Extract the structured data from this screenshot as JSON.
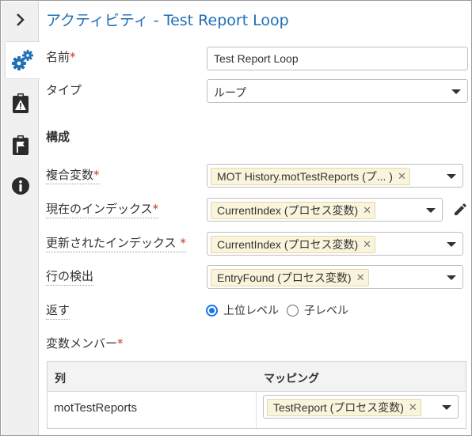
{
  "header": {
    "title": "アクティビティ  - Test Report Loop"
  },
  "sidebar": {
    "items": [
      {
        "name": "collapse",
        "icon": "chevron-right-icon"
      },
      {
        "name": "settings",
        "icon": "gears-icon",
        "active": true
      },
      {
        "name": "warning",
        "icon": "clipboard-warning-icon"
      },
      {
        "name": "flag",
        "icon": "flag-icon"
      },
      {
        "name": "info",
        "icon": "info-icon"
      }
    ]
  },
  "form": {
    "name_label": "名前",
    "name_value": "Test Report Loop",
    "type_label": "タイプ",
    "type_value": "ループ",
    "section_title": "構成",
    "collection_label": "複合変数",
    "collection_chip": "MOT History.motTestReports (プ... )",
    "current_index_label": "現在のインデックス",
    "current_index_chip": "CurrentIndex (プロセス変数)",
    "updated_index_label": "更新されたインデックス",
    "updated_index_chip": "CurrentIndex (プロセス変数)",
    "row_found_label": "行の検出",
    "row_found_chip": "EntryFound (プロセス変数)",
    "return_label": "返す",
    "return_options": [
      "上位レベル",
      "子レベル"
    ],
    "return_selected": "上位レベル",
    "member_label": "変数メンバー",
    "required_mark": "*"
  },
  "mapping_table": {
    "columns": [
      "列",
      "マッピング"
    ],
    "rows": [
      {
        "column": "motTestReports",
        "mapping": "TestReport (プロセス変数)"
      }
    ]
  },
  "colors": {
    "accent": "#1f6fb5",
    "chip_bg": "#fbf4dc",
    "radio": "#1a73e8",
    "required": "#c0392b"
  }
}
